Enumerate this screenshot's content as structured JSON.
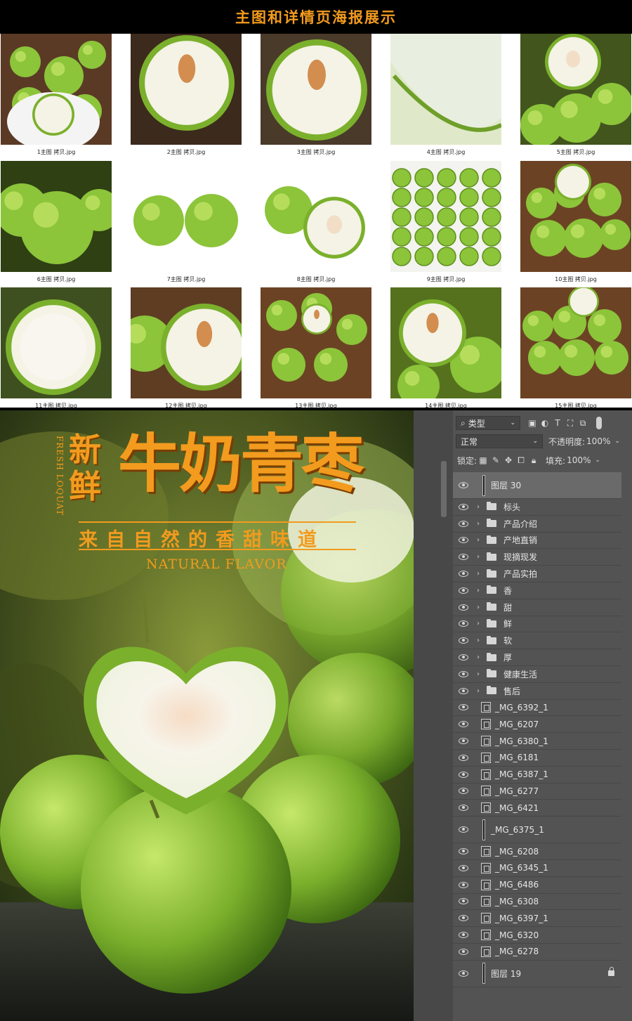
{
  "gallery": {
    "banner": "主图和详情页海报展示",
    "thumbs": [
      {
        "caption": "1主图 拷贝.jpg"
      },
      {
        "caption": "2主图 拷贝.jpg"
      },
      {
        "caption": "3主图 拷贝.jpg"
      },
      {
        "caption": "4主图 拷贝.jpg"
      },
      {
        "caption": "5主图 拷贝.jpg"
      },
      {
        "caption": "6主图 拷贝.jpg"
      },
      {
        "caption": "7主图 拷贝.jpg"
      },
      {
        "caption": "8主图 拷贝.jpg"
      },
      {
        "caption": "9主图 拷贝.jpg"
      },
      {
        "caption": "10主图 拷贝.jpg"
      },
      {
        "caption": "11主图 拷贝.jpg"
      },
      {
        "caption": "12主图 拷贝.jpg"
      },
      {
        "caption": "13主图 拷贝.jpg"
      },
      {
        "caption": "14主图 拷贝.jpg"
      },
      {
        "caption": "15主图 拷贝.jpg"
      }
    ]
  },
  "poster": {
    "side_text": "FRESH LOQUAT",
    "fresh": "新鲜",
    "title": "牛奶青枣",
    "slogan": "来自自然的香甜味道",
    "subtitle": "NATURAL FLAVOR"
  },
  "panel": {
    "filter_label": "类型",
    "blend_mode": "正常",
    "opacity_label": "不透明度:",
    "opacity_value": "100%",
    "lock_label": "锁定:",
    "fill_label": "填充:",
    "fill_value": "100%",
    "layers": [
      {
        "name": "图层 30",
        "kind": "pixel",
        "selected": true
      },
      {
        "name": "标头",
        "kind": "group"
      },
      {
        "name": "产品介绍",
        "kind": "group"
      },
      {
        "name": "产地直销",
        "kind": "group"
      },
      {
        "name": "现摘现发",
        "kind": "group"
      },
      {
        "name": "产品实拍",
        "kind": "group"
      },
      {
        "name": "香",
        "kind": "group"
      },
      {
        "name": "甜",
        "kind": "group"
      },
      {
        "name": "鲜",
        "kind": "group"
      },
      {
        "name": "软",
        "kind": "group"
      },
      {
        "name": "厚",
        "kind": "group"
      },
      {
        "name": "健康生活",
        "kind": "group"
      },
      {
        "name": "售后",
        "kind": "group"
      },
      {
        "name": "_MG_6392_1",
        "kind": "smart"
      },
      {
        "name": "_MG_6207",
        "kind": "smart"
      },
      {
        "name": "_MG_6380_1",
        "kind": "smart"
      },
      {
        "name": "_MG_6181",
        "kind": "smart"
      },
      {
        "name": "_MG_6387_1",
        "kind": "smart"
      },
      {
        "name": "_MG_6277",
        "kind": "smart"
      },
      {
        "name": "_MG_6421",
        "kind": "smart"
      },
      {
        "name": "_MG_6375_1",
        "kind": "pixel"
      },
      {
        "name": "_MG_6208",
        "kind": "smart"
      },
      {
        "name": "_MG_6345_1",
        "kind": "smart"
      },
      {
        "name": "_MG_6486",
        "kind": "smart"
      },
      {
        "name": "_MG_6308",
        "kind": "smart"
      },
      {
        "name": "_MG_6397_1",
        "kind": "smart"
      },
      {
        "name": "_MG_6320",
        "kind": "smart"
      },
      {
        "name": "_MG_6278",
        "kind": "smart"
      },
      {
        "name": "图层 19",
        "kind": "pixel",
        "locked": true
      }
    ]
  }
}
